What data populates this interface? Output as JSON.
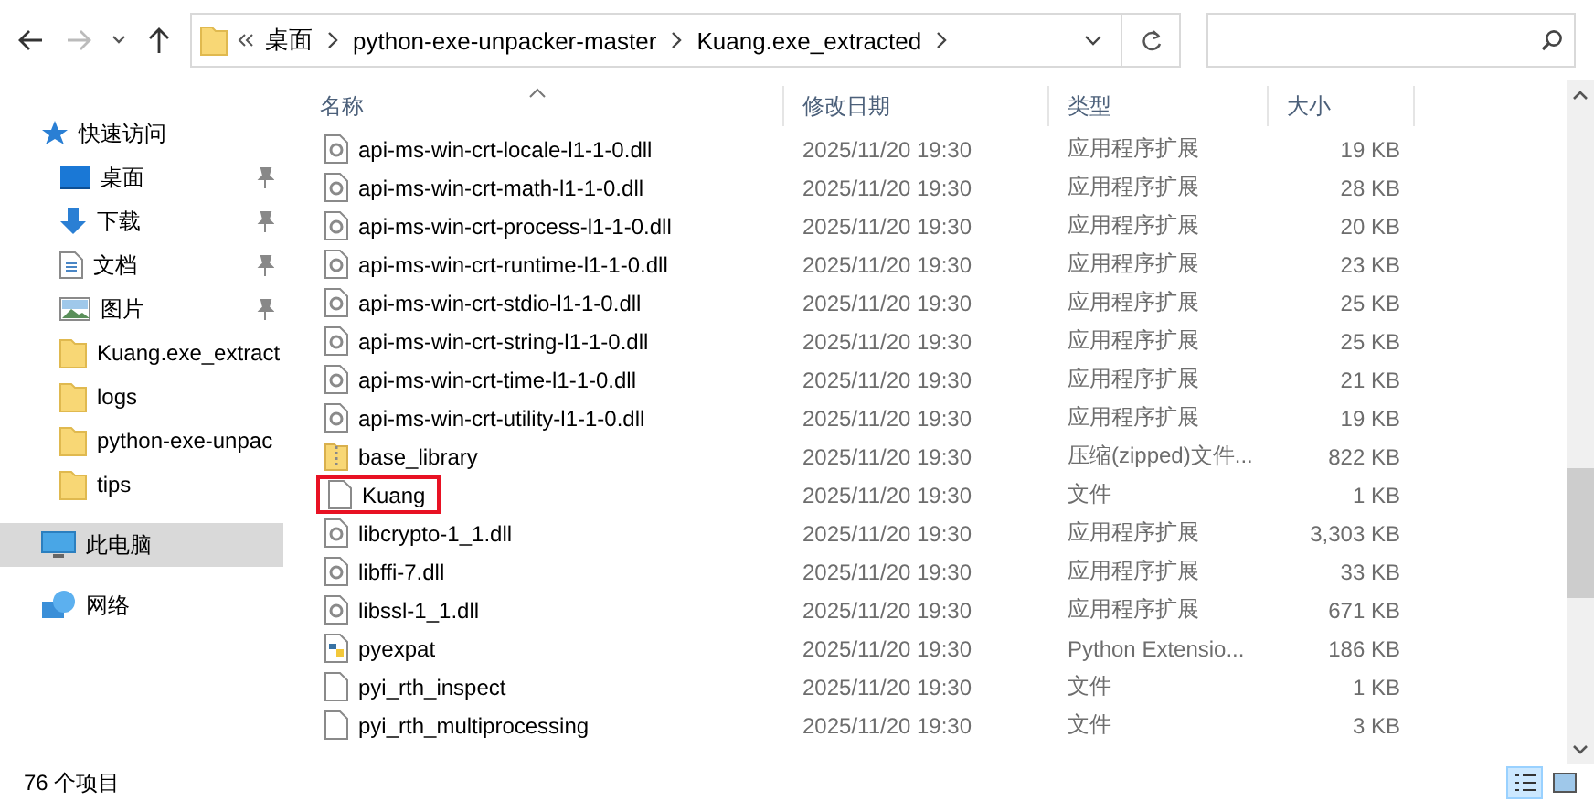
{
  "address_bar": {
    "breadcrumbs": [
      "桌面",
      "python-exe-unpacker-master",
      "Kuang.exe_extracted"
    ]
  },
  "sidebar": {
    "items": [
      {
        "label": "快速访问",
        "kind": "quick",
        "pinned": false,
        "selected": false
      },
      {
        "label": "桌面",
        "kind": "desktop",
        "pinned": true,
        "selected": false
      },
      {
        "label": "下载",
        "kind": "download",
        "pinned": true,
        "selected": false
      },
      {
        "label": "文档",
        "kind": "docs",
        "pinned": true,
        "selected": false
      },
      {
        "label": "图片",
        "kind": "pictures",
        "pinned": true,
        "selected": false
      },
      {
        "label": "Kuang.exe_extract",
        "kind": "folder",
        "pinned": false,
        "selected": false
      },
      {
        "label": "logs",
        "kind": "folder",
        "pinned": false,
        "selected": false
      },
      {
        "label": "python-exe-unpac",
        "kind": "folder",
        "pinned": false,
        "selected": false
      },
      {
        "label": "tips",
        "kind": "folder",
        "pinned": false,
        "selected": false
      },
      {
        "label": "此电脑",
        "kind": "pc",
        "pinned": false,
        "selected": true
      },
      {
        "label": "网络",
        "kind": "network",
        "pinned": false,
        "selected": false
      }
    ]
  },
  "table": {
    "columns": [
      "名称",
      "修改日期",
      "类型",
      "大小"
    ],
    "rows": [
      {
        "name": "api-ms-win-crt-locale-l1-1-0.dll",
        "kind": "dll",
        "date": "2025/11/20 19:30",
        "type": "应用程序扩展",
        "size": "19 KB",
        "highlighted": false
      },
      {
        "name": "api-ms-win-crt-math-l1-1-0.dll",
        "kind": "dll",
        "date": "2025/11/20 19:30",
        "type": "应用程序扩展",
        "size": "28 KB",
        "highlighted": false
      },
      {
        "name": "api-ms-win-crt-process-l1-1-0.dll",
        "kind": "dll",
        "date": "2025/11/20 19:30",
        "type": "应用程序扩展",
        "size": "20 KB",
        "highlighted": false
      },
      {
        "name": "api-ms-win-crt-runtime-l1-1-0.dll",
        "kind": "dll",
        "date": "2025/11/20 19:30",
        "type": "应用程序扩展",
        "size": "23 KB",
        "highlighted": false
      },
      {
        "name": "api-ms-win-crt-stdio-l1-1-0.dll",
        "kind": "dll",
        "date": "2025/11/20 19:30",
        "type": "应用程序扩展",
        "size": "25 KB",
        "highlighted": false
      },
      {
        "name": "api-ms-win-crt-string-l1-1-0.dll",
        "kind": "dll",
        "date": "2025/11/20 19:30",
        "type": "应用程序扩展",
        "size": "25 KB",
        "highlighted": false
      },
      {
        "name": "api-ms-win-crt-time-l1-1-0.dll",
        "kind": "dll",
        "date": "2025/11/20 19:30",
        "type": "应用程序扩展",
        "size": "21 KB",
        "highlighted": false
      },
      {
        "name": "api-ms-win-crt-utility-l1-1-0.dll",
        "kind": "dll",
        "date": "2025/11/20 19:30",
        "type": "应用程序扩展",
        "size": "19 KB",
        "highlighted": false
      },
      {
        "name": "base_library",
        "kind": "zip",
        "date": "2025/11/20 19:30",
        "type": "压缩(zipped)文件...",
        "size": "822 KB",
        "highlighted": false
      },
      {
        "name": "Kuang",
        "kind": "file",
        "date": "2025/11/20 19:30",
        "type": "文件",
        "size": "1 KB",
        "highlighted": true
      },
      {
        "name": "libcrypto-1_1.dll",
        "kind": "dll",
        "date": "2025/11/20 19:30",
        "type": "应用程序扩展",
        "size": "3,303 KB",
        "highlighted": false
      },
      {
        "name": "libffi-7.dll",
        "kind": "dll",
        "date": "2025/11/20 19:30",
        "type": "应用程序扩展",
        "size": "33 KB",
        "highlighted": false
      },
      {
        "name": "libssl-1_1.dll",
        "kind": "dll",
        "date": "2025/11/20 19:30",
        "type": "应用程序扩展",
        "size": "671 KB",
        "highlighted": false
      },
      {
        "name": "pyexpat",
        "kind": "python",
        "date": "2025/11/20 19:30",
        "type": "Python Extensio...",
        "size": "186 KB",
        "highlighted": false
      },
      {
        "name": "pyi_rth_inspect",
        "kind": "file",
        "date": "2025/11/20 19:30",
        "type": "文件",
        "size": "1 KB",
        "highlighted": false
      },
      {
        "name": "pyi_rth_multiprocessing",
        "kind": "file",
        "date": "2025/11/20 19:30",
        "type": "文件",
        "size": "3 KB",
        "highlighted": false
      }
    ]
  },
  "status_bar": {
    "item_count": "76 个项目",
    "views": [
      {
        "kind": "details",
        "selected": true
      },
      {
        "kind": "large",
        "selected": false
      }
    ]
  }
}
